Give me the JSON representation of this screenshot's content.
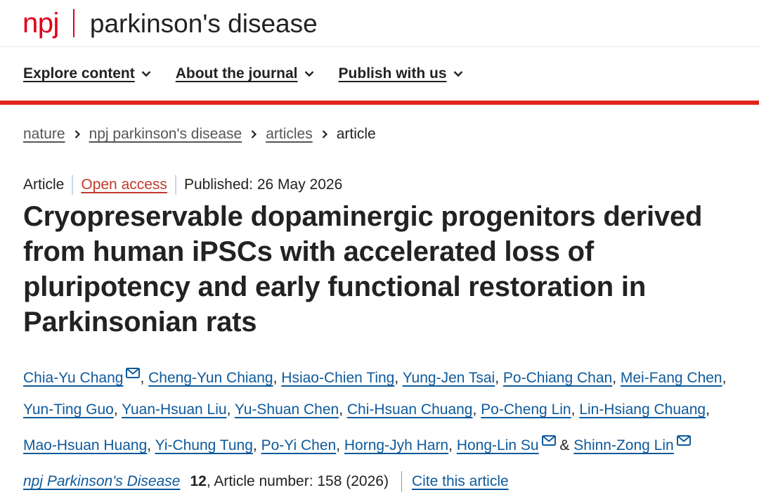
{
  "header": {
    "logo_npj": "npj",
    "journal_title": "parkinson's disease",
    "brand_color": "#e2001a"
  },
  "nav": {
    "items": [
      {
        "label": "Explore content"
      },
      {
        "label": "About the journal"
      },
      {
        "label": "Publish with us"
      }
    ]
  },
  "breadcrumb": {
    "items": [
      "nature",
      "npj parkinson's disease",
      "articles"
    ],
    "current": "article"
  },
  "meta": {
    "type": "Article",
    "access": "Open access",
    "published": "Published: 26 May 2026"
  },
  "article": {
    "title": "Cryopreservable dopaminergic progenitors derived from human iPSCs with accelerated loss of pluripotency and early functional restoration in Parkinsonian rats"
  },
  "authors": [
    {
      "name": "Chia-Yu Chang",
      "email_icon": true
    },
    {
      "name": "Cheng-Yun Chiang"
    },
    {
      "name": "Hsiao-Chien Ting"
    },
    {
      "name": "Yung-Jen Tsai"
    },
    {
      "name": "Po-Chiang Chan"
    },
    {
      "name": "Mei-Fang Chen"
    },
    {
      "name": "Yun-Ting Guo"
    },
    {
      "name": "Yuan-Hsuan Liu"
    },
    {
      "name": "Yu-Shuan Chen"
    },
    {
      "name": "Chi-Hsuan Chuang"
    },
    {
      "name": "Po-Cheng Lin"
    },
    {
      "name": "Lin-Hsiang Chuang"
    },
    {
      "name": "Mao-Hsuan Huang"
    },
    {
      "name": "Yi-Chung Tung"
    },
    {
      "name": "Po-Yi Chen"
    },
    {
      "name": "Horng-Jyh Harn"
    },
    {
      "name": "Hong-Lin Su",
      "email_icon": true
    },
    {
      "name": "Shinn-Zong Lin",
      "email_icon": true
    }
  ],
  "authors_separators": {
    "comma": ",",
    "ampersand": "&"
  },
  "citation": {
    "journal": "npj Parkinson's Disease",
    "volume": "12",
    "article_number": ", Article number: 158 (2026)",
    "cite_label": "Cite this article"
  },
  "colors": {
    "link": "#0e5a9c",
    "open_access": "#c0392b",
    "nav_rule": "#e2231a"
  }
}
